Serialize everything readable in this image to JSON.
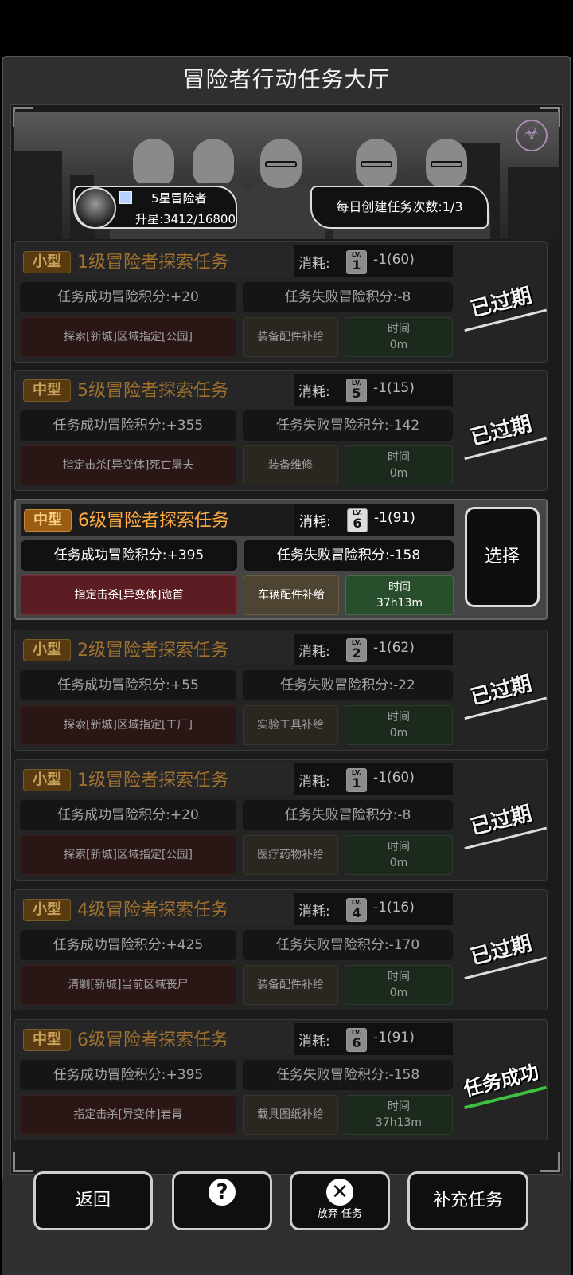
{
  "header": {
    "title": "冒险者行动任务大厅"
  },
  "player": {
    "rank": "5星冒险者",
    "xp": "升星:3412/16800"
  },
  "daily": {
    "text": "每日创建任务次数:1/3"
  },
  "cost_label": "消耗:",
  "lv_label": "LV.",
  "time_label": "时间",
  "missions": [
    {
      "tag": "小型",
      "title": "1级冒险者探索任务",
      "lv": "1",
      "cost": "-1(60)",
      "success": "任务成功冒险积分:+20",
      "fail": "任务失败冒险积分:-8",
      "target": "探索[新城]区域指定[公园]",
      "supply": "装备配件补给",
      "time": "0m",
      "status": "已过期"
    },
    {
      "tag": "中型",
      "title": "5级冒险者探索任务",
      "lv": "5",
      "cost": "-1(15)",
      "success": "任务成功冒险积分:+355",
      "fail": "任务失败冒险积分:-142",
      "target": "指定击杀[异变体]死亡屠夫",
      "supply": "装备维修",
      "time": "0m",
      "status": "已过期"
    },
    {
      "tag": "中型",
      "title": "6级冒险者探索任务",
      "lv": "6",
      "cost": "-1(91)",
      "success": "任务成功冒险积分:+395",
      "fail": "任务失败冒险积分:-158",
      "target": "指定击杀[异变体]诡首",
      "supply": "车辆配件补给",
      "time": "37h13m",
      "status": "选择"
    },
    {
      "tag": "小型",
      "title": "2级冒险者探索任务",
      "lv": "2",
      "cost": "-1(62)",
      "success": "任务成功冒险积分:+55",
      "fail": "任务失败冒险积分:-22",
      "target": "探索[新城]区域指定[工厂]",
      "supply": "实验工具补给",
      "time": "0m",
      "status": "已过期"
    },
    {
      "tag": "小型",
      "title": "1级冒险者探索任务",
      "lv": "1",
      "cost": "-1(60)",
      "success": "任务成功冒险积分:+20",
      "fail": "任务失败冒险积分:-8",
      "target": "探索[新城]区域指定[公园]",
      "supply": "医疗药物补给",
      "time": "0m",
      "status": "已过期"
    },
    {
      "tag": "小型",
      "title": "4级冒险者探索任务",
      "lv": "4",
      "cost": "-1(16)",
      "success": "任务成功冒险积分:+425",
      "fail": "任务失败冒险积分:-170",
      "target": "清剿[新城]当前区域丧尸",
      "supply": "装备配件补给",
      "time": "0m",
      "status": "已过期"
    },
    {
      "tag": "中型",
      "title": "6级冒险者探索任务",
      "lv": "6",
      "cost": "-1(91)",
      "success": "任务成功冒险积分:+395",
      "fail": "任务失败冒险积分:-158",
      "target": "指定击杀[异变体]岩胄",
      "supply": "载具图纸补给",
      "time": "37h13m",
      "status": "任务成功"
    }
  ],
  "footer": {
    "back": "返回",
    "help_icon": "question-map-icon",
    "abandon_icon": "x-circle-icon",
    "abandon": "放弃 任务",
    "refill": "补充任务"
  },
  "colors": {
    "accent": "#ffab42",
    "success_line": "#3fbf3f",
    "target_active": "#5c1d22",
    "time_active": "#284e2c"
  }
}
